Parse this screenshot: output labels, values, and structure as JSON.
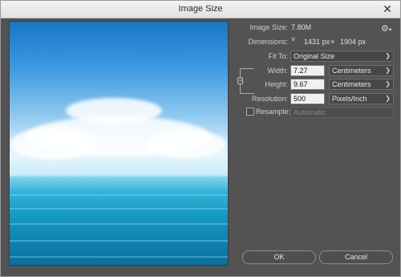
{
  "window": {
    "title": "Image Size",
    "close_glyph": "✕"
  },
  "info": {
    "image_size_label": "Image Size:",
    "image_size_value": "7.80M",
    "dimensions_label": "Dimensions:",
    "dimensions_arrow": "˅",
    "dimensions_width": "1431 px",
    "dimensions_times": "×",
    "dimensions_height": "1904 px"
  },
  "fit_to": {
    "label": "Fit To:",
    "value": "Original Size"
  },
  "width": {
    "label": "Width:",
    "value": "7.27",
    "unit": "Centimeters"
  },
  "height": {
    "label": "Height:",
    "value": "9.67",
    "unit": "Centimeters"
  },
  "resolution": {
    "label": "Resolution:",
    "value": "500",
    "unit": "Pixels/Inch"
  },
  "resample": {
    "label": "Resample:",
    "value": "Automatic",
    "checked": false
  },
  "buttons": {
    "ok": "OK",
    "cancel": "Cancel"
  },
  "icons": {
    "gear": "gear-icon",
    "link": "link-chain-icon",
    "chevron": "chevron-down-icon"
  },
  "colors": {
    "dialog_bg": "#535353",
    "input_bg": "#f0f0f0"
  }
}
